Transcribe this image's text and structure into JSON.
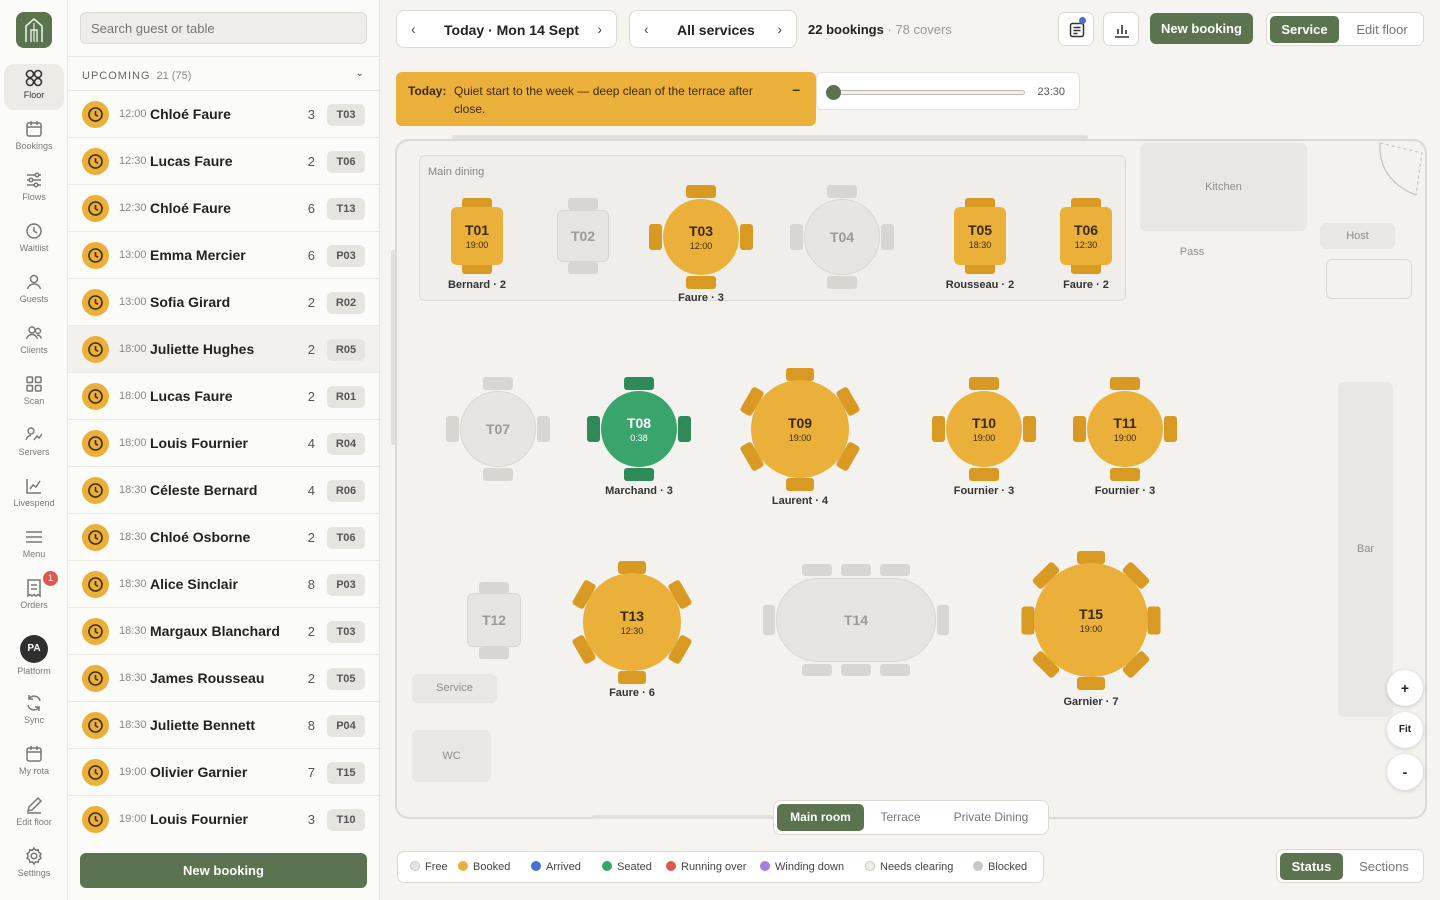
{
  "rail": {
    "items": [
      {
        "label": "Floor",
        "icon": "grid-icon"
      },
      {
        "label": "Bookings",
        "icon": "calendar-icon"
      },
      {
        "label": "Flows",
        "icon": "sliders-icon"
      },
      {
        "label": "Waitlist",
        "icon": "clock-icon"
      },
      {
        "label": "Guests",
        "icon": "user-icon"
      },
      {
        "label": "Clients",
        "icon": "users-icon"
      },
      {
        "label": "Scan",
        "icon": "scan-icon"
      },
      {
        "label": "Servers",
        "icon": "servers-icon"
      },
      {
        "label": "Livespend",
        "icon": "chart-line-icon"
      },
      {
        "label": "Menu",
        "icon": "menu-icon"
      },
      {
        "label": "Orders",
        "icon": "receipt-icon",
        "badge": "1"
      },
      {
        "label": "Platform",
        "icon": "avatar",
        "initials": "PA"
      },
      {
        "label": "Sync",
        "icon": "sync-icon"
      },
      {
        "label": "My rota",
        "icon": "calendar-icon"
      },
      {
        "label": "Edit floor",
        "icon": "pencil-icon"
      },
      {
        "label": "Settings",
        "icon": "gear-icon"
      }
    ]
  },
  "sidebar": {
    "search_placeholder": "Search guest or table",
    "section_title": "UPCOMING",
    "section_count": "21 (75)",
    "new_booking": "New booking",
    "bookings": [
      {
        "time": "12:00",
        "name": "Chloé Faure",
        "covers": "3",
        "table": "T03"
      },
      {
        "time": "12:30",
        "name": "Lucas Faure",
        "covers": "2",
        "table": "T06"
      },
      {
        "time": "12:30",
        "name": "Chloé Faure",
        "covers": "6",
        "table": "T13"
      },
      {
        "time": "13:00",
        "name": "Emma Mercier",
        "covers": "6",
        "table": "P03"
      },
      {
        "time": "13:00",
        "name": "Sofia Girard",
        "covers": "2",
        "table": "R02"
      },
      {
        "time": "18:00",
        "name": "Juliette Hughes",
        "covers": "2",
        "table": "R05"
      },
      {
        "time": "18:00",
        "name": "Lucas Faure",
        "covers": "2",
        "table": "R01"
      },
      {
        "time": "18:00",
        "name": "Louis Fournier",
        "covers": "4",
        "table": "R04"
      },
      {
        "time": "18:30",
        "name": "Céleste Bernard",
        "covers": "4",
        "table": "R06"
      },
      {
        "time": "18:30",
        "name": "Chloé Osborne",
        "covers": "2",
        "table": "T06"
      },
      {
        "time": "18:30",
        "name": "Alice Sinclair",
        "covers": "8",
        "table": "P03"
      },
      {
        "time": "18:30",
        "name": "Margaux Blanchard",
        "covers": "2",
        "table": "T03"
      },
      {
        "time": "18:30",
        "name": "James Rousseau",
        "covers": "2",
        "table": "T05"
      },
      {
        "time": "18:30",
        "name": "Juliette Bennett",
        "covers": "8",
        "table": "P04"
      },
      {
        "time": "19:00",
        "name": "Olivier Garnier",
        "covers": "7",
        "table": "T15"
      },
      {
        "time": "19:00",
        "name": "Louis Fournier",
        "covers": "3",
        "table": "T10"
      }
    ]
  },
  "topbar": {
    "date": "Today · Mon 14 Sept",
    "service": "All services",
    "bookings": "22 bookings",
    "covers": "· 78 covers",
    "new_booking": "New booking",
    "mode_service": "Service",
    "mode_edit": "Edit floor"
  },
  "notice": {
    "label": "Today:",
    "text": "Quiet start to the week — deep clean of the terrace after close.",
    "collapse": "–"
  },
  "timeline": {
    "time": "23:30",
    "position": 0.0
  },
  "floor": {
    "main_dining": "Main dining",
    "zones": {
      "kitchen": "Kitchen",
      "pass": "Pass",
      "host": "Host",
      "bar": "Bar",
      "service": "Service",
      "wc": "WC"
    },
    "tables": [
      {
        "id": "T01",
        "time": "19:00",
        "label": "Bernard · 2",
        "status": "booked"
      },
      {
        "id": "T02",
        "time": "",
        "label": "",
        "status": "free"
      },
      {
        "id": "T03",
        "time": "12:00",
        "label": "Faure · 3",
        "status": "booked"
      },
      {
        "id": "T04",
        "time": "",
        "label": "",
        "status": "free"
      },
      {
        "id": "T05",
        "time": "18:30",
        "label": "Rousseau · 2",
        "status": "booked"
      },
      {
        "id": "T06",
        "time": "12:30",
        "label": "Faure · 2",
        "status": "booked"
      },
      {
        "id": "T07",
        "time": "",
        "label": "",
        "status": "free"
      },
      {
        "id": "T08",
        "time": "0:38",
        "label": "Marchand · 3",
        "status": "seated"
      },
      {
        "id": "T09",
        "time": "19:00",
        "label": "Laurent · 4",
        "status": "booked"
      },
      {
        "id": "T10",
        "time": "19:00",
        "label": "Fournier · 3",
        "status": "booked"
      },
      {
        "id": "T11",
        "time": "19:00",
        "label": "Fournier · 3",
        "status": "booked"
      },
      {
        "id": "T12",
        "time": "",
        "label": "",
        "status": "free"
      },
      {
        "id": "T13",
        "time": "12:30",
        "label": "Faure · 6",
        "status": "booked"
      },
      {
        "id": "T14",
        "time": "",
        "label": "",
        "status": "free"
      },
      {
        "id": "T15",
        "time": "19:00",
        "label": "Garnier · 7",
        "status": "booked"
      }
    ],
    "zoom_in": "+",
    "zoom_fit": "Fit",
    "zoom_out": "-"
  },
  "rooms": [
    "Main room",
    "Terrace",
    "Private Dining"
  ],
  "legend": [
    {
      "label": "Free",
      "color": "#e6e5e1"
    },
    {
      "label": "Booked",
      "color": "#ebb03a"
    },
    {
      "label": "Arrived",
      "color": "#4b6fd6"
    },
    {
      "label": "Seated",
      "color": "#39a46b"
    },
    {
      "label": "Running over",
      "color": "#e0584d"
    },
    {
      "label": "Winding down",
      "color": "#a77fdc"
    },
    {
      "label": "Needs clearing",
      "color": "#efeee9"
    },
    {
      "label": "Blocked",
      "color": "#c9c8c4"
    }
  ],
  "view_toggle": {
    "status": "Status",
    "sections": "Sections"
  }
}
